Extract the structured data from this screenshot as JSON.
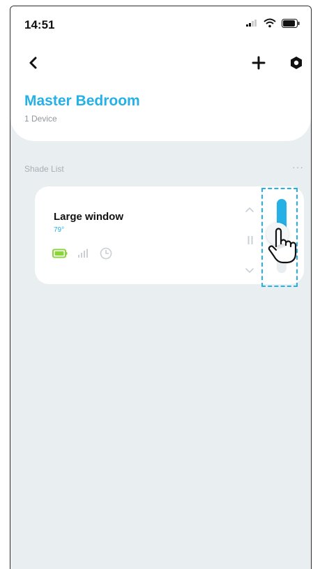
{
  "status_bar": {
    "time": "14:51"
  },
  "nav": {
    "back_icon": "chevron-left-icon",
    "add_icon": "plus-icon",
    "settings_icon": "hexagon-settings-icon"
  },
  "room": {
    "title": "Master Bedroom",
    "subtitle": "1 Device"
  },
  "shade_section": {
    "label": "Shade List",
    "more": "···"
  },
  "shade": {
    "name": "Large window",
    "temperature": "79°",
    "position_fraction": 0.55,
    "battery_color": "#8ad63a"
  },
  "colors": {
    "accent": "#25b0e6",
    "background": "#e9eef0"
  }
}
